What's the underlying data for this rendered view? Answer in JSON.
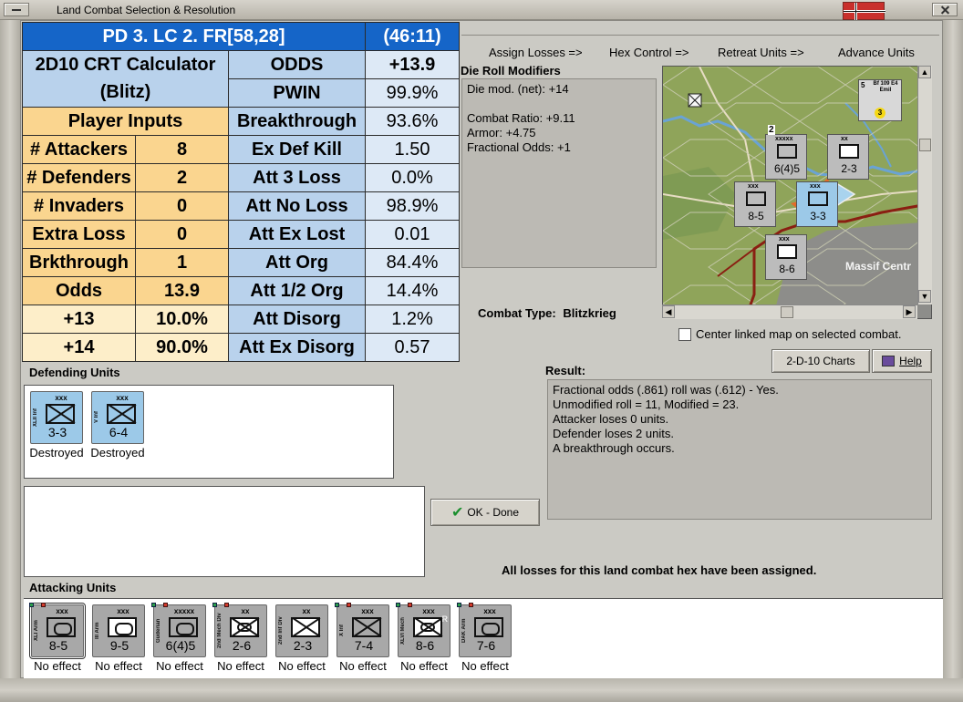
{
  "window": {
    "title": "Land Combat Selection & Resolution"
  },
  "crt": {
    "header_left": "PD 3.  LC 2.  FR[58,28]",
    "header_right": "(46:11)",
    "calc_title_1": "2D10 CRT Calculator",
    "calc_title_2": "(Blitz)",
    "player_inputs": "Player Inputs",
    "inputs": [
      {
        "label": "# Attackers",
        "value": "8"
      },
      {
        "label": "# Defenders",
        "value": "2"
      },
      {
        "label": "# Invaders",
        "value": "0"
      },
      {
        "label": "Extra Loss",
        "value": "0"
      },
      {
        "label": "Brkthrough",
        "value": "1"
      },
      {
        "label": "Odds",
        "value": "13.9"
      }
    ],
    "odds_rows": [
      {
        "label": "+13",
        "value": "10.0%"
      },
      {
        "label": "+14",
        "value": "90.0%"
      }
    ],
    "results": [
      {
        "label": "ODDS",
        "value": "+13.9"
      },
      {
        "label": "PWIN",
        "value": "99.9%"
      },
      {
        "label": "Breakthrough",
        "value": "93.6%"
      },
      {
        "label": "Ex Def Kill",
        "value": "1.50"
      },
      {
        "label": "Att 3 Loss",
        "value": "0.0%"
      },
      {
        "label": "Att No Loss",
        "value": "98.9%"
      },
      {
        "label": "Att Ex Lost",
        "value": "0.01"
      },
      {
        "label": "Att Org",
        "value": "84.4%"
      },
      {
        "label": "Att 1/2 Org",
        "value": "14.4%"
      },
      {
        "label": "Att Disorg",
        "value": "1.2%"
      },
      {
        "label": "Att Ex Disorg",
        "value": "0.57"
      }
    ]
  },
  "actions": {
    "assign_losses": "Assign Losses =>",
    "hex_control": "Hex Control =>",
    "retreat_units": "Retreat Units =>",
    "advance_units": "Advance Units"
  },
  "die_roll": {
    "title": "Die Roll Modifiers",
    "lines": [
      "Die mod. (net): +14",
      "",
      "Combat Ratio: +9.11",
      "Armor: +4.75",
      "Fractional Odds: +1"
    ]
  },
  "map": {
    "label": "Massif Centr",
    "counters": [
      {
        "name": "Guderian",
        "size": "xxxxx",
        "strength": "6(4)5"
      },
      {
        "name": "3rd Inf Div",
        "size": "xx",
        "strength": "2-3"
      },
      {
        "name": "XLI Arm",
        "size": "xxx",
        "strength": "8-5"
      },
      {
        "name": "XLI Inf",
        "size": "xxx",
        "strength": "3-3"
      },
      {
        "name": "XLVI Mech",
        "size": "xxx",
        "strength": "8-6"
      },
      {
        "name": "Bf 109",
        "size": "5",
        "strength": "3"
      }
    ],
    "stack_num": "2",
    "air_num": "5",
    "air_label": "Bf 109 E4 Emil"
  },
  "combat_type": {
    "label": "Combat Type:",
    "value": "Blitzkrieg"
  },
  "center_linked": "Center linked map on selected combat.",
  "buttons": {
    "charts": "2-D-10 Charts",
    "help": "Help",
    "ok": "OK - Done"
  },
  "result": {
    "title": "Result:",
    "lines": [
      "Fractional odds (.861) roll was (.612)  - Yes.",
      "Unmodified roll = 11, Modified = 23.",
      "Attacker loses 0 units.",
      "Defender loses 2 units.",
      "A breakthrough occurs."
    ]
  },
  "defending": {
    "title": "Defending Units",
    "units": [
      {
        "vtext": "XLII Inf",
        "size": "xxx",
        "strength": "3-3",
        "status": "Destroyed"
      },
      {
        "vtext": "V Inf",
        "size": "xxx",
        "strength": "6-4",
        "status": "Destroyed"
      }
    ]
  },
  "attacking": {
    "title": "Attacking Units",
    "units": [
      {
        "vtext": "XLI Arm",
        "size": "xxx",
        "strength": "8-5",
        "status": "No effect",
        "sym": "arm"
      },
      {
        "vtext": "III Arm",
        "size": "xxx",
        "strength": "9-5",
        "status": "No effect",
        "sym": "arm-white"
      },
      {
        "vtext": "Guderian",
        "size": "xxxxx",
        "strength": "6(4)5",
        "status": "No effect",
        "sym": "arm"
      },
      {
        "vtext": "2nd Mech Div",
        "size": "xx",
        "strength": "2-6",
        "status": "No effect",
        "sym": "mech"
      },
      {
        "vtext": "2nd Inf Div",
        "size": "xx",
        "strength": "2-3",
        "status": "No effect",
        "sym": "inf-white"
      },
      {
        "vtext": "X Inf",
        "size": "xxx",
        "strength": "7-4",
        "status": "No effect",
        "sym": "inf"
      },
      {
        "vtext": "XLVI Mech",
        "size": "xxx",
        "strength": "8-6",
        "status": "No effect",
        "sym": "mech"
      },
      {
        "vtext": "DAK Arm",
        "size": "xxx",
        "strength": "7-6",
        "status": "No effect",
        "sym": "arm"
      }
    ],
    "r_tag": "R"
  },
  "losses_message": "All losses for this land combat hex have been assigned."
}
